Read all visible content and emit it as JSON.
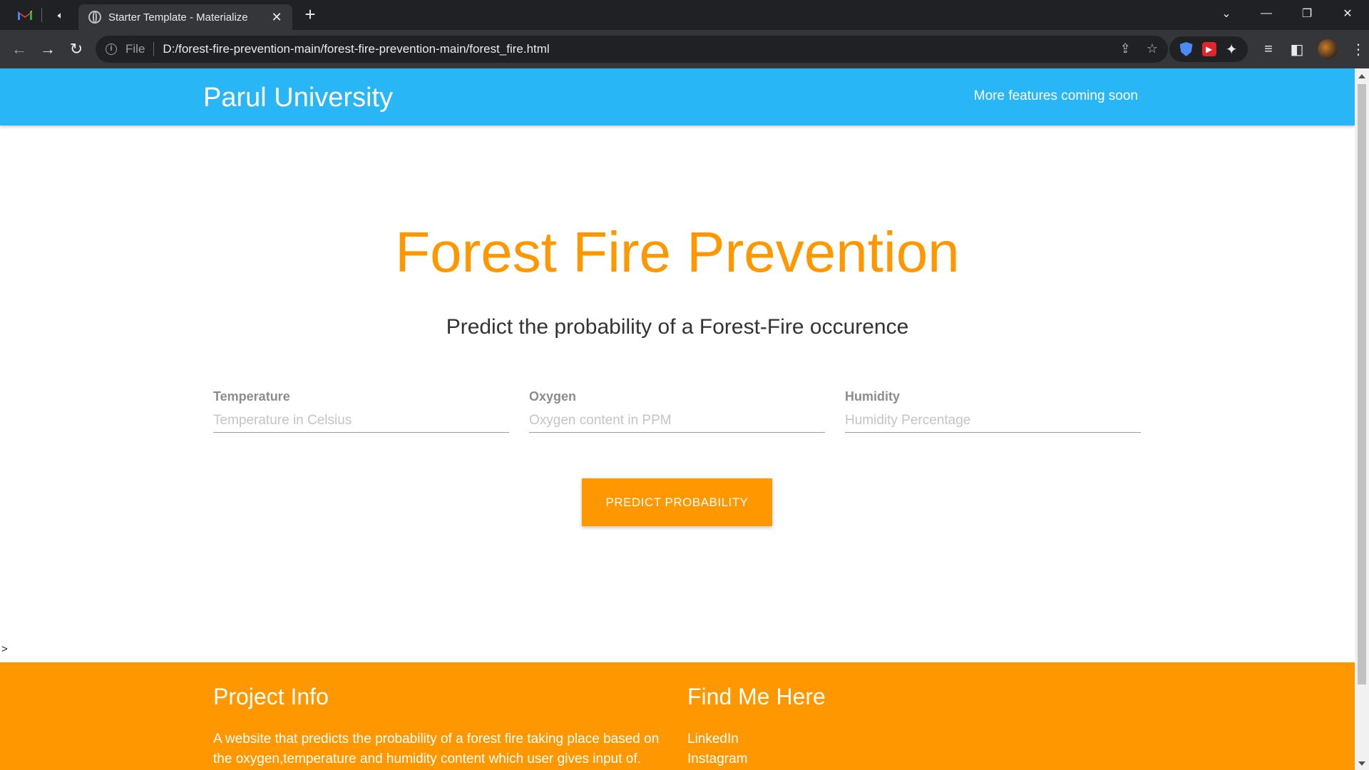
{
  "browser": {
    "tab_title": "Starter Template - Materialize",
    "new_tab": "+",
    "tab_close": "✕",
    "address_scheme": "File",
    "address_url": "D:/forest-fire-prevention-main/forest-fire-prevention-main/forest_fire.html"
  },
  "navbar": {
    "brand": "Parul University",
    "link": "More features coming soon"
  },
  "hero": {
    "title": "Forest Fire Prevention",
    "subtitle": "Predict the probability of a Forest-Fire occurence"
  },
  "form": {
    "temperature": {
      "label": "Temperature",
      "placeholder": "Temperature in Celsius"
    },
    "oxygen": {
      "label": "Oxygen",
      "placeholder": "Oxygen content in PPM"
    },
    "humidity": {
      "label": "Humidity",
      "placeholder": "Humidity Percentage"
    },
    "submit": "PREDICT PROBABILITY"
  },
  "stray_text": ">",
  "footer": {
    "project_title": "Project Info",
    "project_text": "A website that predicts the probability of a forest fire taking place based on the oxygen,temperature and humidity content which user gives input of.",
    "find_title": "Find Me Here",
    "links": [
      "LinkedIn",
      "Instagram"
    ]
  },
  "colors": {
    "navbar": "#29b6f6",
    "accent": "#ff9800"
  }
}
